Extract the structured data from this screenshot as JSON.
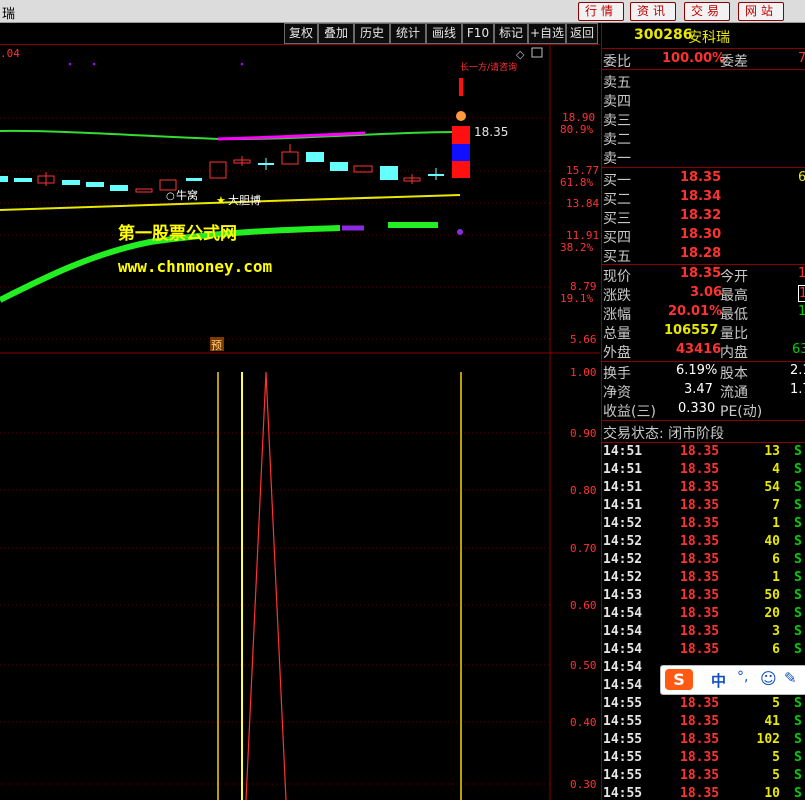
{
  "app": {
    "title": "瑞"
  },
  "top_buttons": [
    "行情",
    "资讯",
    "交易",
    "网站"
  ],
  "toolbar": [
    "复权",
    "叠加",
    "历史",
    "统计",
    "画线",
    "F10",
    "标记",
    "+自选",
    "返回"
  ],
  "colors": {
    "up": "#ff3232",
    "down": "#00d000",
    "accent_yellow": "#e8e800",
    "magenta": "#ff00ff"
  },
  "chart": {
    "corner_value": ".04",
    "watermark_title": "第一股票公式网",
    "watermark_url": "www.chnmoney.com",
    "annotation_niuwo": "牛窝",
    "annotation_dadanbo": "大胆博",
    "annotation_yu": "预",
    "last_price_label": "18.35",
    "top_tag": "长一方/请咨询",
    "price_axis": [
      {
        "value": "18.90",
        "pct": "80.9%"
      },
      {
        "value": "15.77",
        "pct": "61.8%"
      },
      {
        "value": "13.84",
        "pct": ""
      },
      {
        "value": "11.91",
        "pct": "38.2%"
      },
      {
        "value": "8.79",
        "pct": "19.1%"
      },
      {
        "value": "5.66",
        "pct": ""
      }
    ],
    "indicator_axis": [
      "1.00",
      "0.90",
      "0.80",
      "0.70",
      "0.60",
      "0.50",
      "0.40",
      "0.30"
    ]
  },
  "chart_data": {
    "type": "line",
    "indicator_axis_range": [
      0.3,
      1.0
    ],
    "indicator_peak": 1.0,
    "price_axis_range": [
      5.66,
      18.9
    ]
  },
  "quote": {
    "code": "300286",
    "name": "安科瑞",
    "weibi_label": "委比",
    "weibi_value": "100.00%",
    "weicha_label": "委差",
    "weicha_value": "7",
    "sell": [
      {
        "label": "卖五",
        "price": "",
        "vol": ""
      },
      {
        "label": "卖四",
        "price": "",
        "vol": ""
      },
      {
        "label": "卖三",
        "price": "",
        "vol": ""
      },
      {
        "label": "卖二",
        "price": "",
        "vol": ""
      },
      {
        "label": "卖一",
        "price": "",
        "vol": ""
      }
    ],
    "buy": [
      {
        "label": "买一",
        "price": "18.35",
        "vol": "6"
      },
      {
        "label": "买二",
        "price": "18.34",
        "vol": ""
      },
      {
        "label": "买三",
        "price": "18.32",
        "vol": ""
      },
      {
        "label": "买四",
        "price": "18.30",
        "vol": ""
      },
      {
        "label": "买五",
        "price": "18.28",
        "vol": ""
      }
    ],
    "stats": [
      {
        "l1": "现价",
        "v1": "18.35",
        "c1": "red",
        "l2": "今开",
        "v2": "1"
      },
      {
        "l1": "涨跌",
        "v1": "3.06",
        "c1": "red",
        "l2": "最高",
        "v2": "1"
      },
      {
        "l1": "涨幅",
        "v1": "20.01%",
        "c1": "red",
        "l2": "最低",
        "v2": "1"
      },
      {
        "l1": "总量",
        "v1": "106557",
        "c1": "yel",
        "l2": "量比",
        "v2": ""
      },
      {
        "l1": "外盘",
        "v1": "43416",
        "c1": "red",
        "l2": "内盘",
        "v2": "63"
      }
    ],
    "stats2": [
      {
        "l1": "换手",
        "v1": "6.19%",
        "l2": "股本",
        "v2": "2.1"
      },
      {
        "l1": "净资",
        "v1": "3.47",
        "l2": "流通",
        "v2": "1.7"
      },
      {
        "l1": "收益(三)",
        "v1": "0.330",
        "l2": "PE(动)",
        "v2": ""
      }
    ],
    "status": "交易状态: 闭市阶段"
  },
  "ticks": [
    {
      "t": "14:51",
      "p": "18.35",
      "v": "13",
      "s": "S"
    },
    {
      "t": "14:51",
      "p": "18.35",
      "v": "4",
      "s": "S"
    },
    {
      "t": "14:51",
      "p": "18.35",
      "v": "54",
      "s": "S"
    },
    {
      "t": "14:51",
      "p": "18.35",
      "v": "7",
      "s": "S"
    },
    {
      "t": "14:52",
      "p": "18.35",
      "v": "1",
      "s": "S"
    },
    {
      "t": "14:52",
      "p": "18.35",
      "v": "40",
      "s": "S"
    },
    {
      "t": "14:52",
      "p": "18.35",
      "v": "6",
      "s": "S"
    },
    {
      "t": "14:52",
      "p": "18.35",
      "v": "1",
      "s": "S"
    },
    {
      "t": "14:53",
      "p": "18.35",
      "v": "50",
      "s": "S"
    },
    {
      "t": "14:54",
      "p": "18.35",
      "v": "20",
      "s": "S"
    },
    {
      "t": "14:54",
      "p": "18.35",
      "v": "3",
      "s": "S"
    },
    {
      "t": "14:54",
      "p": "18.35",
      "v": "6",
      "s": "S"
    },
    {
      "t": "14:54",
      "p": "",
      "v": "",
      "s": ""
    },
    {
      "t": "14:54",
      "p": "",
      "v": "",
      "s": ""
    },
    {
      "t": "14:55",
      "p": "18.35",
      "v": "5",
      "s": "S"
    },
    {
      "t": "14:55",
      "p": "18.35",
      "v": "41",
      "s": "S"
    },
    {
      "t": "14:55",
      "p": "18.35",
      "v": "102",
      "s": "S"
    },
    {
      "t": "14:55",
      "p": "18.35",
      "v": "5",
      "s": "S"
    },
    {
      "t": "14:55",
      "p": "18.35",
      "v": "5",
      "s": "S"
    },
    {
      "t": "14:55",
      "p": "18.35",
      "v": "10",
      "s": "S"
    }
  ],
  "ime": {
    "lang": "中",
    "punct": "°,"
  }
}
